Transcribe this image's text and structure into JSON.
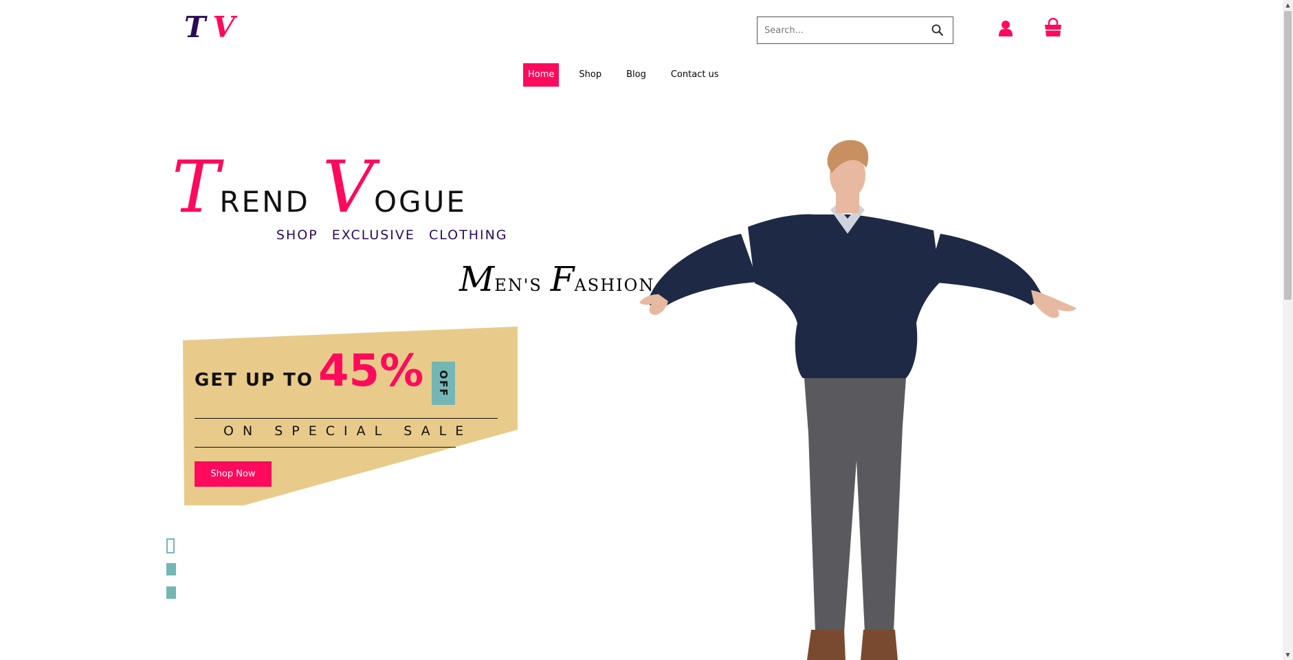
{
  "header": {
    "logo_t": "T",
    "logo_v": "V",
    "search_placeholder": "Search...",
    "search_icon": "search-icon",
    "user_icon": "user-icon",
    "cart_icon": "shopping-bag-icon"
  },
  "nav": {
    "items": [
      {
        "label": "Home",
        "active": true
      },
      {
        "label": "Shop",
        "active": false
      },
      {
        "label": "Blog",
        "active": false
      },
      {
        "label": "Contact us",
        "active": false
      }
    ]
  },
  "hero": {
    "brand": {
      "word1_cap": "T",
      "word1_rest": "REND",
      "word2_cap": "V",
      "word2_rest": "OGUE"
    },
    "tagline": "SHOP EXCLUSIVE CLOTHING",
    "mens": {
      "word1_cap": "M",
      "word1_rest": "EN'S",
      "word2_cap": "F",
      "word2_rest": "ASHION"
    },
    "promo": {
      "get_up_to": "GET UP TO",
      "percent": "45%",
      "off": "OFF",
      "special": "ON SPECIAL SALE",
      "button": "Shop Now"
    },
    "social_icons": [
      "social-icon-1",
      "social-icon-2",
      "social-icon-3"
    ],
    "image": "man-in-navy-sweater-arms-outstretched"
  },
  "colors": {
    "accent": "#ff0a5c",
    "dark_purple": "#2b0a55",
    "promo_bg": "#e8cb8a",
    "teal": "#74b6b4"
  }
}
